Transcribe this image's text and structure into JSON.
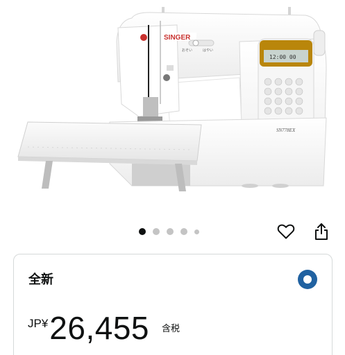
{
  "product_image": {
    "brand": "SINGER",
    "model": "SN778EX",
    "dial_labels": [
      "おそい",
      "はやい"
    ],
    "lcd_text": "12:00 00"
  },
  "carousel": {
    "dot_count": 5,
    "active_index": 0
  },
  "actions": {
    "wishlist_icon": "heart-icon",
    "share_icon": "share-icon"
  },
  "offer": {
    "condition": "全新",
    "selected": true,
    "currency": "JP¥",
    "price": "26,455",
    "tax_note": "含税"
  },
  "colors": {
    "radio": "#2162a1",
    "text": "#0f1111",
    "dot_inactive": "#c4c4c4",
    "lcd": "#b9860b"
  }
}
